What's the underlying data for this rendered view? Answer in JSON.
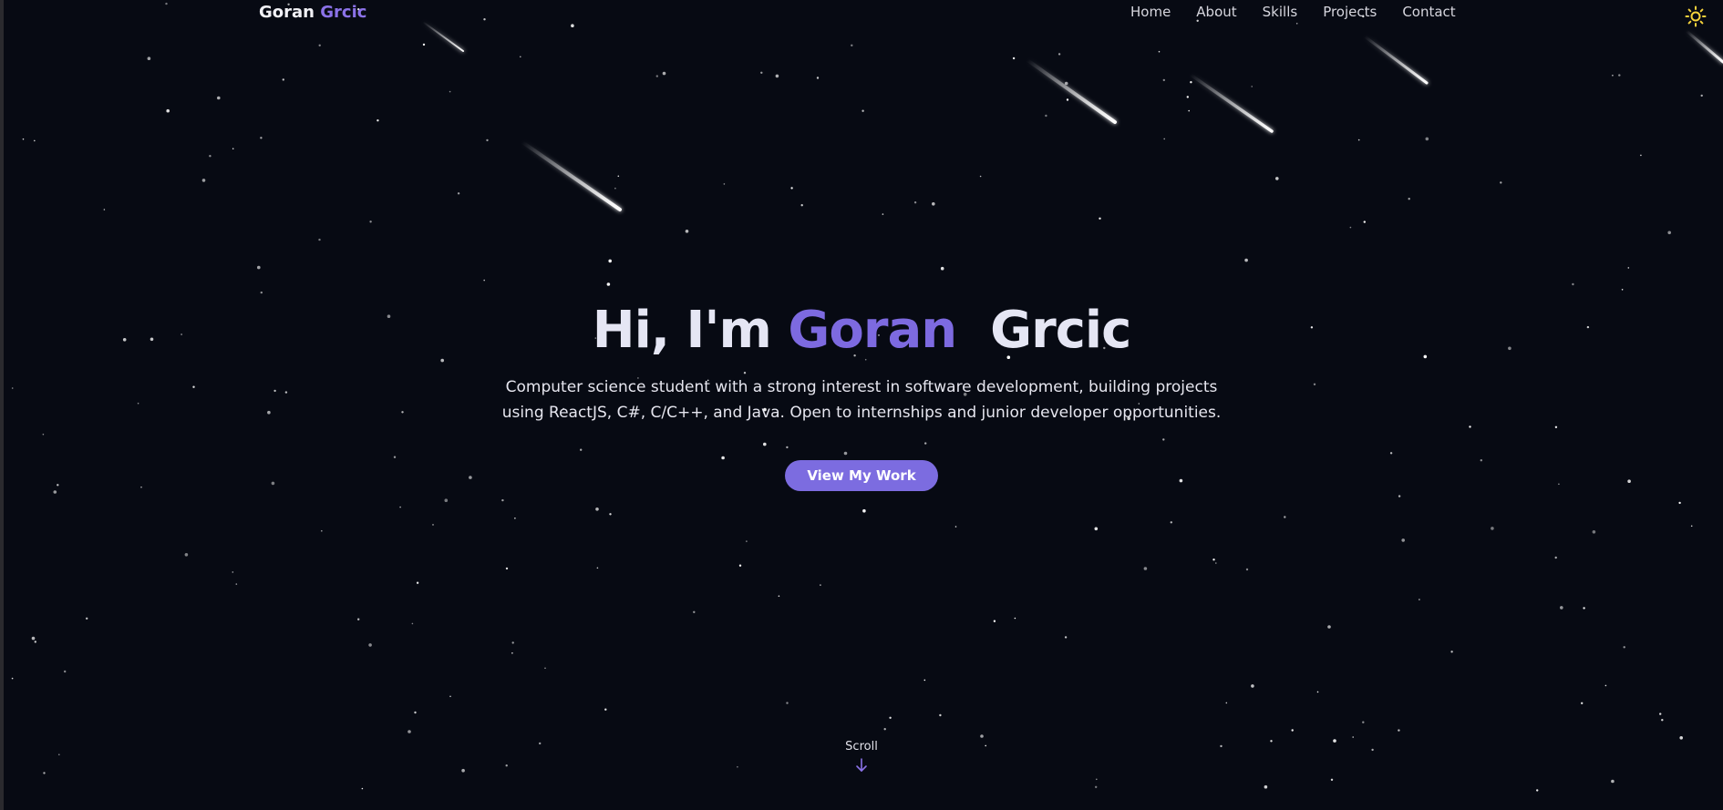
{
  "brand": {
    "first": "Goran",
    "last": "Grcic"
  },
  "nav": {
    "items": [
      {
        "label": "Home"
      },
      {
        "label": "About"
      },
      {
        "label": "Skills"
      },
      {
        "label": "Projects"
      },
      {
        "label": "Contact"
      }
    ]
  },
  "theme_toggle": {
    "icon": "sun-icon",
    "color": "#f5d23c"
  },
  "hero": {
    "greeting": "Hi, I'm",
    "first_name": "Goran",
    "last_name": "Grcic",
    "description": "Computer science student with a strong interest in software development, building projects using ReactJS, C#, C/C++, and Java. Open to internships and junior developer opportunities.",
    "cta_label": "View My Work"
  },
  "scroll": {
    "label": "Scroll",
    "icon": "arrow-down-icon"
  },
  "colors": {
    "background": "#070a13",
    "accent": "#7c6ce0",
    "text": "#e6e6ef"
  }
}
